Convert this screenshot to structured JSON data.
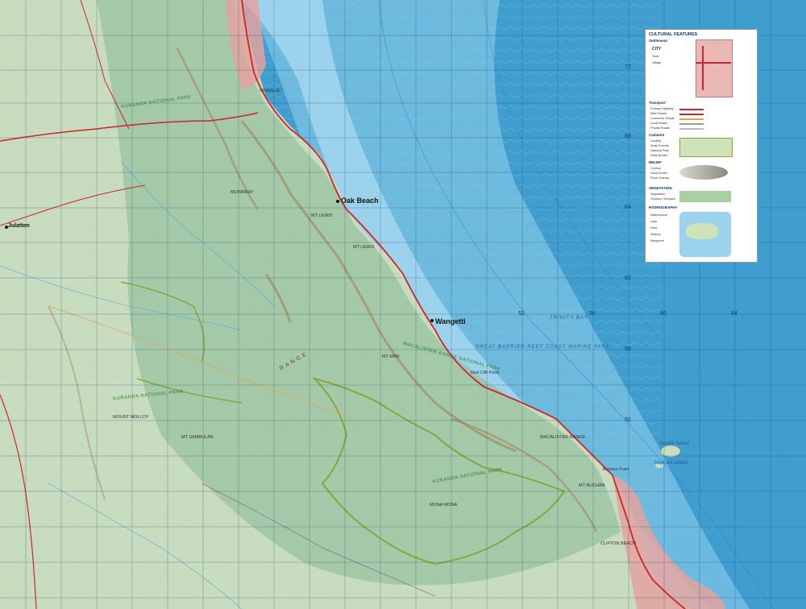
{
  "map": {
    "colors": {
      "ocean_deep": "#3f9ecf",
      "ocean_mid": "#6cbadf",
      "ocean_shallow": "#9bd3ee",
      "land": "#c8dcc0",
      "forest": "#98c3a0",
      "road": "#d0232a",
      "grid": "#0d3b66",
      "contour": "#a07a50",
      "park_boundary": "#8aa63a",
      "urban": "#e2a2a0"
    },
    "places": [
      {
        "id": "oak-beach",
        "name": "Oak Beach",
        "kind": "town"
      },
      {
        "id": "wangetti",
        "name": "Wangetti",
        "kind": "town"
      },
      {
        "id": "craiglie",
        "name": "CRAIGLIE",
        "kind": "small"
      },
      {
        "id": "julatten",
        "name": "Julatten",
        "kind": "town"
      },
      {
        "id": "mona-mona",
        "name": "MONA MONA",
        "kind": "small"
      },
      {
        "id": "clifton-beach",
        "name": "CLIFTON BEACH",
        "kind": "small"
      },
      {
        "id": "mowbray",
        "name": "MOWBRAY",
        "kind": "small"
      },
      {
        "id": "mount-molloy",
        "name": "MOUNT MOLLOY",
        "kind": "small"
      },
      {
        "id": "mt-lewis",
        "name": "MT LEWIS",
        "kind": "small"
      },
      {
        "id": "mt-sambulan",
        "name": "MT SAMBULAN",
        "kind": "small"
      },
      {
        "id": "mt-mar",
        "name": "MT MAR",
        "kind": "small"
      },
      {
        "id": "mt-buchan",
        "name": "MT BUCHAN",
        "kind": "small"
      },
      {
        "id": "mt-lewis-2",
        "name": "MT LEWIS",
        "kind": "small"
      },
      {
        "id": "macalister-range",
        "name": "MACALISTER RANGE",
        "kind": "small"
      },
      {
        "id": "barron-gorge",
        "name": "KUNANDA NATIONAL PARK",
        "kind": "park"
      },
      {
        "id": "macalister-np",
        "name": "MACALISTER RANGE NATIONAL PARK",
        "kind": "park"
      },
      {
        "id": "kuranda-np",
        "name": "KURANDA NATIONAL PARK",
        "kind": "park"
      },
      {
        "id": "kuranda-np-2",
        "name": "KURANDA NATIONAL PARK",
        "kind": "park"
      },
      {
        "id": "great-barrier-reef",
        "name": "GREAT BARRIER REEF COAST MARINE PARK",
        "kind": "water"
      },
      {
        "id": "trinity-bay",
        "name": "TRINITY BAY",
        "kind": "water"
      },
      {
        "id": "double-island",
        "name": "Double Island",
        "kind": "island"
      },
      {
        "id": "haycock-island",
        "name": "Haycock Island",
        "kind": "island"
      },
      {
        "id": "range-label",
        "name": "RANGE",
        "kind": "range"
      },
      {
        "id": "red-cliff-point",
        "name": "Red Cliff Point",
        "kind": "small"
      },
      {
        "id": "buchan-point",
        "name": "Buchan Point",
        "kind": "small"
      }
    ],
    "grid_labels_y": [
      "72",
      "68",
      "64",
      "60",
      "56",
      "52"
    ],
    "grid_labels_x": [
      "52",
      "56",
      "60",
      "64"
    ]
  },
  "legend": {
    "title": "CULTURAL FEATURES",
    "sections": [
      {
        "id": "settlement",
        "heading": "Settlement",
        "items": [
          "CITY",
          "Town",
          "Village"
        ]
      },
      {
        "id": "transport",
        "heading": "Transport",
        "items": [
          "Primary Highway",
          "Main Roads",
          "Connector Roads",
          "Local Roads",
          "Private Roads"
        ]
      },
      {
        "id": "cadastre",
        "heading": "Cadastre",
        "items": [
          "Locality",
          "State Forests",
          "National Park",
          "State Border"
        ]
      },
      {
        "id": "relief",
        "heading": "RELIEF",
        "items": [
          "Contour",
          "Sand Dunes",
          "Rock Outcrop"
        ]
      },
      {
        "id": "vegetation",
        "heading": "VEGETATION",
        "items": [
          "Vegetation",
          "Orchard, Vineyard"
        ]
      },
      {
        "id": "hydrography",
        "heading": "HYDROGRAPHY",
        "items": [
          "Watercourse",
          "Lake",
          "Reef",
          "Swamp",
          "Mangrove"
        ]
      }
    ]
  }
}
